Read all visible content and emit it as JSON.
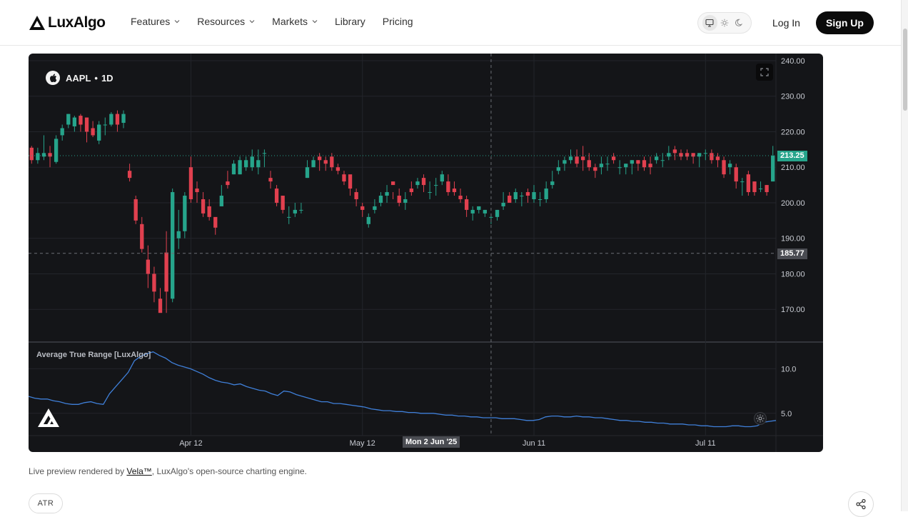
{
  "header": {
    "logo_text": "LuxAlgo",
    "nav": [
      {
        "label": "Features",
        "has_dropdown": true
      },
      {
        "label": "Resources",
        "has_dropdown": true
      },
      {
        "label": "Markets",
        "has_dropdown": true
      },
      {
        "label": "Library",
        "has_dropdown": false
      },
      {
        "label": "Pricing",
        "has_dropdown": false
      }
    ],
    "theme_options": [
      "monitor-icon",
      "sun-icon",
      "moon-icon"
    ],
    "theme_selected": "monitor-icon",
    "login_label": "Log In",
    "signup_label": "Sign Up"
  },
  "chart_panel": {
    "symbol": "AAPL",
    "separator": "•",
    "interval": "1D",
    "indicator_label": "Average True Range [LuxAlgo]",
    "last_price_tag": "213.25",
    "crosshair_price_tag": "185.77",
    "crosshair_date_tag": "Mon 2 Jun '25",
    "colors": {
      "background": "#141518",
      "up": "#26a48b",
      "down": "#e1404f",
      "atr_line": "#3f7fd8",
      "grid": "#23252b"
    }
  },
  "chart_data": [
    {
      "type": "candlestick",
      "symbol": "AAPL",
      "interval": "1D",
      "ylim": [
        161,
        242
      ],
      "y_ticks": [
        "240.00",
        "230.00",
        "220.00",
        "210.00",
        "200.00",
        "190.00",
        "180.00",
        "170.00"
      ],
      "x_ticks": [
        {
          "label": "Apr 12",
          "index": 26
        },
        {
          "label": "May 12",
          "index": 54
        },
        {
          "label": "Jun 11",
          "index": 82
        },
        {
          "label": "Jul 11",
          "index": 110
        }
      ],
      "last_price": 213.25,
      "crosshair_price": 185.77,
      "crosshair_index": 75,
      "candles": [
        [
          215.5,
          212,
          216,
          211
        ],
        [
          212,
          214,
          215.5,
          211
        ],
        [
          213,
          214,
          219,
          212
        ],
        [
          214,
          213,
          216,
          210
        ],
        [
          211.5,
          218,
          219,
          211
        ],
        [
          219,
          221,
          222,
          217.5
        ],
        [
          222,
          225,
          225,
          221
        ],
        [
          221.5,
          224,
          224.5,
          220
        ],
        [
          224.5,
          222,
          225,
          220
        ],
        [
          224,
          220,
          224,
          217
        ],
        [
          221,
          219,
          223,
          218.5
        ],
        [
          217.5,
          222,
          223,
          216.5
        ],
        [
          222,
          222,
          224,
          219
        ],
        [
          222,
          225,
          225.5,
          221.5
        ],
        [
          225,
          222,
          226,
          220
        ],
        [
          222.5,
          225,
          226,
          221
        ],
        [
          209,
          207,
          211,
          206
        ],
        [
          201,
          195,
          202,
          194
        ],
        [
          194,
          187,
          196,
          186
        ],
        [
          184,
          180,
          188,
          176
        ],
        [
          180,
          175,
          182,
          172
        ],
        [
          173,
          169,
          176,
          170
        ],
        [
          186,
          175,
          192,
          169
        ],
        [
          173,
          203,
          204,
          172
        ],
        [
          190,
          192,
          198,
          187
        ],
        [
          192,
          202,
          203,
          190
        ],
        [
          210,
          201,
          213,
          200
        ],
        [
          204,
          203,
          206,
          200
        ],
        [
          201,
          197,
          203,
          196
        ],
        [
          199,
          196,
          201,
          195
        ],
        [
          196,
          193,
          195,
          191
        ],
        [
          199,
          202,
          205,
          199
        ],
        [
          206,
          205,
          209,
          204
        ],
        [
          208,
          211,
          212,
          208
        ],
        [
          208,
          212,
          213,
          208
        ],
        [
          210,
          212,
          213,
          209
        ],
        [
          210,
          213,
          215,
          209
        ],
        [
          210,
          212,
          215,
          208
        ],
        [
          214,
          214,
          215,
          210
        ],
        [
          207,
          206,
          209,
          204
        ],
        [
          204,
          200,
          205,
          199
        ],
        [
          202,
          198,
          200,
          197
        ],
        [
          196,
          196,
          199,
          194
        ],
        [
          197,
          198,
          200,
          196
        ],
        [
          198,
          198,
          200,
          197
        ],
        [
          207,
          210,
          212,
          207
        ],
        [
          210,
          212,
          213,
          210
        ],
        [
          213,
          212,
          214,
          209
        ],
        [
          212,
          211,
          213,
          209
        ],
        [
          213,
          210,
          214,
          209
        ],
        [
          210,
          209,
          211,
          208
        ],
        [
          208,
          206,
          209,
          205
        ],
        [
          208,
          204,
          207,
          202
        ],
        [
          203,
          201,
          204,
          199
        ],
        [
          199,
          198,
          200,
          196
        ],
        [
          194,
          196,
          197,
          193
        ],
        [
          198,
          199,
          201,
          197
        ],
        [
          200,
          202,
          203,
          199
        ],
        [
          202,
          203,
          205,
          200
        ],
        [
          206,
          205,
          203,
          201
        ],
        [
          202,
          200,
          204,
          199
        ],
        [
          200,
          201,
          203,
          198
        ],
        [
          204,
          203,
          206,
          202
        ],
        [
          205,
          206,
          207,
          204
        ],
        [
          207,
          205,
          208,
          203
        ],
        [
          203,
          203,
          206,
          201
        ],
        [
          205,
          205,
          207,
          202
        ],
        [
          206,
          208,
          209,
          205
        ],
        [
          206,
          203,
          208,
          202
        ],
        [
          204,
          203,
          206,
          202
        ],
        [
          202,
          201,
          204,
          200
        ],
        [
          201,
          198,
          202,
          196
        ],
        [
          197,
          198,
          199,
          195
        ],
        [
          198,
          199,
          199,
          197
        ],
        [
          197,
          198,
          198,
          196
        ],
        [
          196,
          196,
          197,
          194
        ],
        [
          196,
          198,
          198,
          195
        ],
        [
          199,
          200,
          203,
          198
        ],
        [
          202,
          200,
          203,
          200
        ],
        [
          201,
          203,
          204,
          200
        ],
        [
          202,
          202,
          203,
          199
        ],
        [
          203,
          202,
          204,
          200
        ],
        [
          201,
          203,
          205,
          200
        ],
        [
          201,
          201,
          203,
          199
        ],
        [
          201,
          204,
          206,
          200
        ],
        [
          205,
          206,
          209,
          204
        ],
        [
          209,
          210,
          212,
          208
        ],
        [
          211,
          212,
          213,
          209
        ],
        [
          212,
          213,
          215,
          211
        ],
        [
          213,
          211,
          215,
          210
        ],
        [
          213,
          212,
          216,
          209
        ],
        [
          212,
          210,
          214,
          209
        ],
        [
          210,
          209,
          211,
          207
        ],
        [
          210,
          211,
          213,
          208
        ],
        [
          211,
          211,
          213,
          209
        ],
        [
          213,
          212,
          214,
          211
        ],
        [
          210,
          210,
          212,
          208
        ],
        [
          210,
          211,
          211,
          208
        ],
        [
          211,
          212,
          212,
          208
        ],
        [
          212,
          211,
          212,
          209
        ],
        [
          212,
          210,
          213,
          209
        ],
        [
          211,
          210,
          213,
          208
        ],
        [
          212,
          213,
          214,
          211
        ],
        [
          212,
          212,
          214,
          210
        ],
        [
          213,
          214,
          216,
          212
        ],
        [
          215,
          214,
          216,
          212
        ],
        [
          214,
          213,
          215,
          212
        ],
        [
          214,
          213,
          215,
          212
        ],
        [
          214,
          213,
          214,
          211
        ],
        [
          213,
          214,
          214,
          210
        ],
        [
          214,
          214,
          215,
          212
        ],
        [
          214,
          212,
          215,
          211
        ],
        [
          213,
          212,
          214,
          210
        ],
        [
          212,
          208,
          213,
          207
        ],
        [
          210,
          211,
          212,
          208
        ],
        [
          210,
          206,
          211,
          204
        ],
        [
          206,
          206,
          207,
          202
        ],
        [
          208,
          203,
          209,
          202
        ],
        [
          206,
          203,
          206,
          202
        ],
        [
          204,
          204,
          206,
          203
        ],
        [
          205,
          203,
          205,
          202
        ],
        [
          206,
          213.25,
          216,
          206
        ]
      ]
    },
    {
      "type": "line",
      "title": "Average True Range [LuxAlgo]",
      "ylim": [
        2.5,
        13
      ],
      "y_ticks": [
        "10.0",
        "5.0"
      ],
      "values": [
        6.9,
        6.7,
        6.6,
        6.6,
        6.4,
        6.3,
        6.1,
        6.0,
        6.0,
        6.2,
        6.3,
        6.1,
        6.0,
        7.2,
        8.0,
        8.8,
        9.6,
        10.9,
        11.4,
        11.7,
        11.9,
        11.5,
        11.2,
        10.7,
        10.4,
        10.2,
        10.0,
        9.7,
        9.4,
        9.0,
        8.7,
        8.5,
        8.4,
        8.2,
        8.3,
        8.0,
        7.8,
        7.6,
        7.5,
        7.2,
        7.0,
        7.5,
        7.4,
        7.1,
        6.9,
        6.7,
        6.5,
        6.3,
        6.3,
        6.1,
        6.1,
        6.0,
        5.9,
        5.8,
        5.7,
        5.5,
        5.4,
        5.3,
        5.3,
        5.2,
        5.2,
        5.1,
        5.1,
        5.0,
        5.0,
        5.0,
        4.9,
        4.8,
        4.8,
        4.7,
        4.7,
        4.6,
        4.6,
        4.5,
        4.5,
        4.5,
        4.4,
        4.4,
        4.4,
        4.3,
        4.2,
        4.2,
        4.3,
        4.6,
        4.7,
        4.7,
        4.6,
        4.6,
        4.7,
        4.6,
        4.6,
        4.5,
        4.5,
        4.4,
        4.3,
        4.2,
        4.2,
        4.1,
        4.1,
        4.0,
        4.0,
        3.9,
        3.9,
        3.8,
        3.8,
        3.8,
        3.7,
        3.7,
        3.6,
        3.6,
        3.5,
        3.5,
        3.5,
        3.6,
        3.6,
        3.5,
        3.5,
        3.6,
        4.0,
        4.1,
        4.2
      ]
    }
  ],
  "footer": {
    "caption_prefix": "Live preview rendered by ",
    "caption_link": "Vela™",
    "caption_suffix": ", LuxAlgo's open-source charting engine.",
    "tag": "ATR"
  }
}
